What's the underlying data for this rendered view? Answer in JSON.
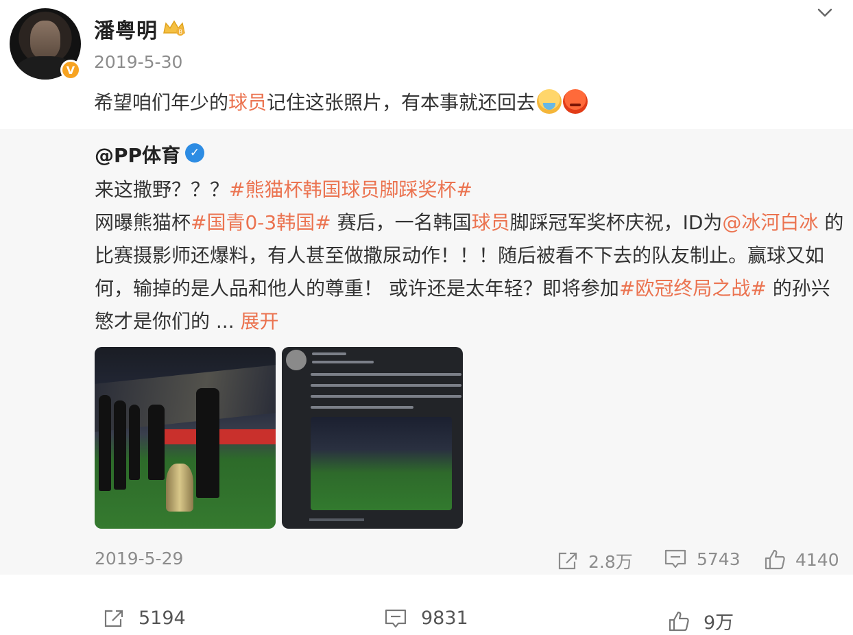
{
  "post": {
    "username": "潘粤明",
    "date": "2019-5-30",
    "text_parts": [
      "希望咱们年少的",
      "球员",
      "记住这张照片，有本事就还回去"
    ],
    "emojis": [
      "sweat-face-emoji",
      "angry-face-emoji"
    ]
  },
  "repost": {
    "username": "@PP体育",
    "lines": [
      [
        "来这撒野？？？",
        "#熊猫杯韩国球员脚踩奖杯#"
      ],
      [
        "网曝熊猫杯",
        "#国青0-3韩国#",
        " 赛后，一名韩国",
        "球员",
        "脚踩冠军奖杯庆祝，ID为",
        "@冰河白冰",
        " 的"
      ],
      [
        "比赛摄影师还爆料，有人甚至做撒尿动作！！！随后被看不下去的队友制止。赢球又如"
      ],
      [
        "何，输掉的是人品和他人的尊重！ 或许还是太年轻？即将参加",
        "#欧冠终局之战#",
        " 的孙兴"
      ],
      [
        "慜才是你们的 ... ",
        "展开"
      ]
    ],
    "date": "2019-5-29",
    "shares": "2.8万",
    "comments": "5743",
    "likes": "4140"
  },
  "footer": {
    "shares": "5194",
    "comments": "9831",
    "likes": "9万"
  },
  "colors": {
    "highlight": "#eb7350",
    "verified_blue": "#2d8ce3",
    "verified_orange": "#f7a321"
  }
}
